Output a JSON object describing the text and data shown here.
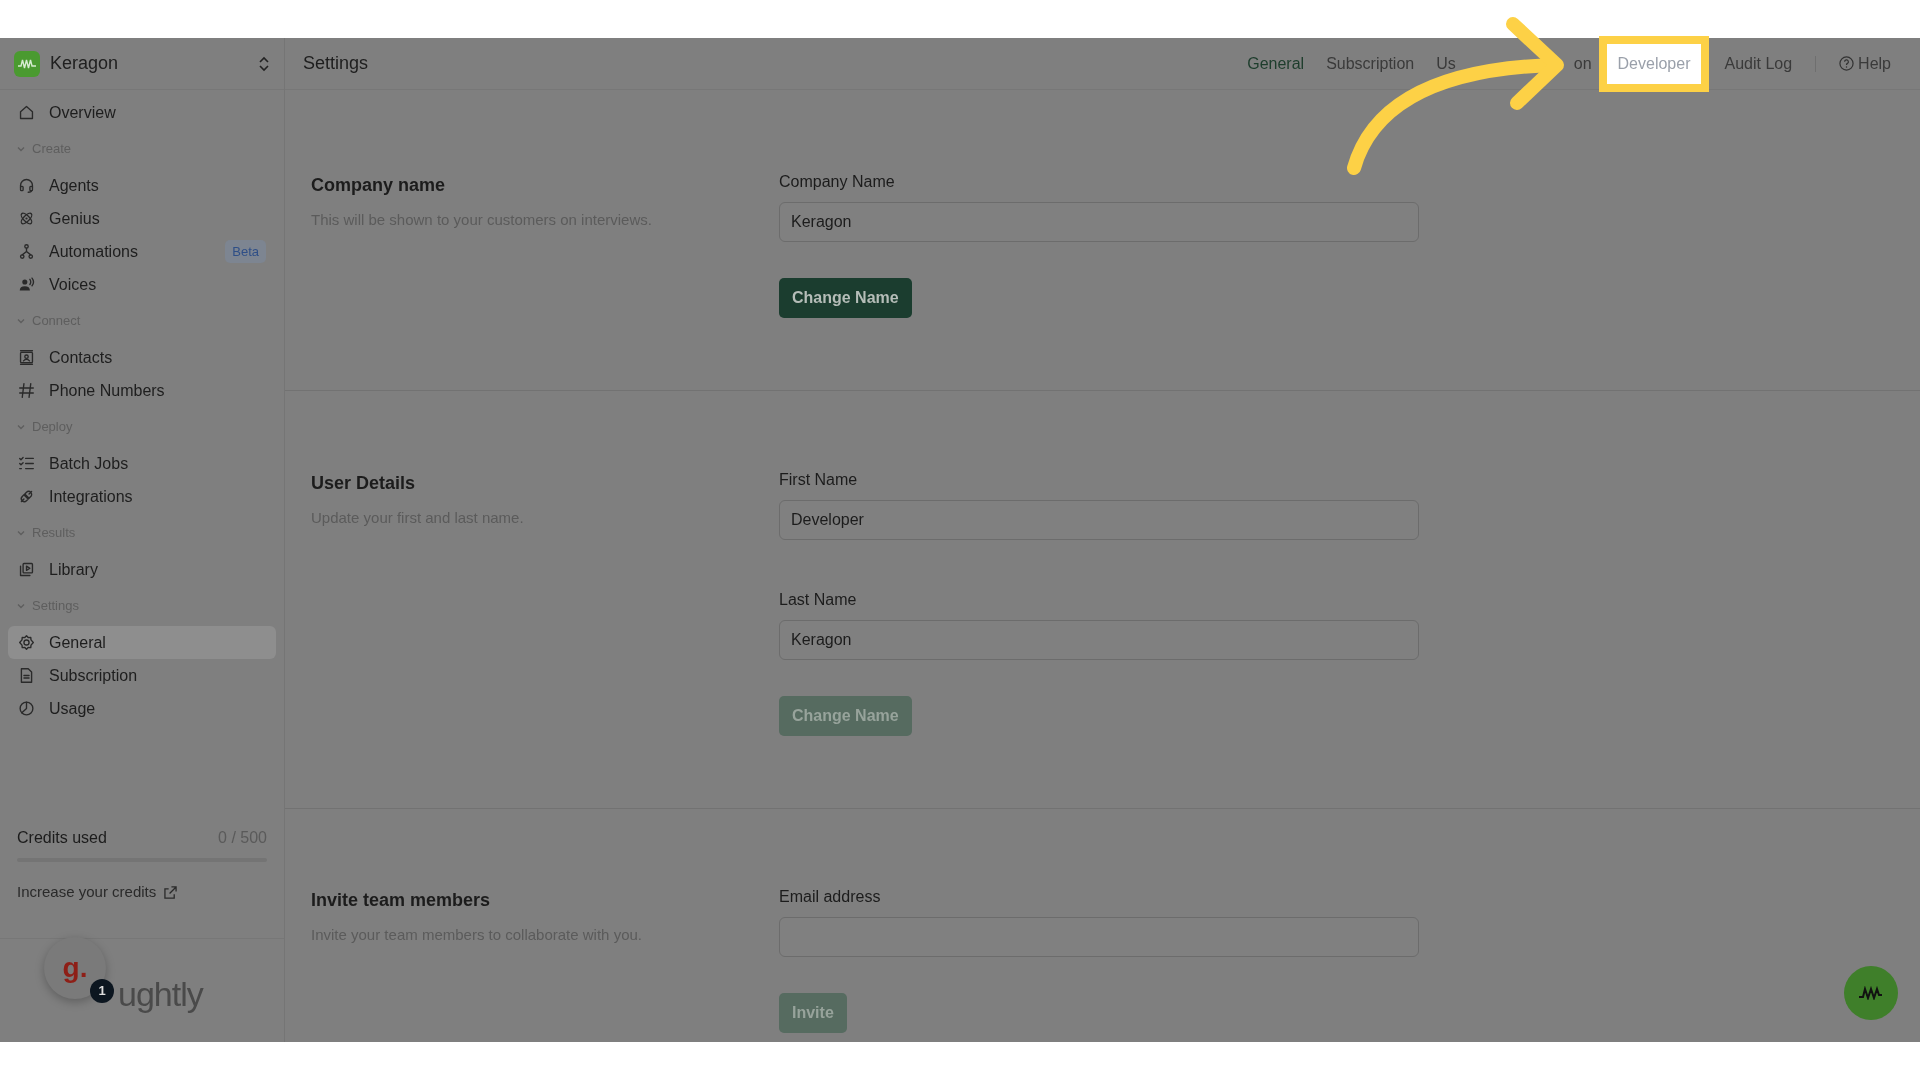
{
  "workspace": {
    "name": "Keragon"
  },
  "sidebar": {
    "items": [
      {
        "kind": "item",
        "label": "Overview",
        "selected": false
      },
      {
        "kind": "section",
        "label": "Create"
      },
      {
        "kind": "item",
        "label": "Agents",
        "selected": false
      },
      {
        "kind": "item",
        "label": "Genius",
        "selected": false
      },
      {
        "kind": "item",
        "label": "Automations",
        "selected": false,
        "badge": "Beta"
      },
      {
        "kind": "item",
        "label": "Voices",
        "selected": false
      },
      {
        "kind": "section",
        "label": "Connect"
      },
      {
        "kind": "item",
        "label": "Contacts",
        "selected": false
      },
      {
        "kind": "item",
        "label": "Phone Numbers",
        "selected": false
      },
      {
        "kind": "section",
        "label": "Deploy"
      },
      {
        "kind": "item",
        "label": "Batch Jobs",
        "selected": false
      },
      {
        "kind": "item",
        "label": "Integrations",
        "selected": false
      },
      {
        "kind": "section",
        "label": "Results"
      },
      {
        "kind": "item",
        "label": "Library",
        "selected": false
      },
      {
        "kind": "section",
        "label": "Settings"
      },
      {
        "kind": "item",
        "label": "General",
        "selected": true
      },
      {
        "kind": "item",
        "label": "Subscription",
        "selected": false
      },
      {
        "kind": "item",
        "label": "Usage",
        "selected": false
      }
    ],
    "credits": {
      "label": "Credits used",
      "value": "0 / 500",
      "level": 0
    },
    "credits_link": "Increase your credits",
    "widget": {
      "badge": "1",
      "logo_letter": "g.",
      "logo_text": "ughtly"
    }
  },
  "header": {
    "title": "Settings",
    "tabs": [
      {
        "label": "General",
        "selected": true,
        "highlighted": false
      },
      {
        "label": "Subscription",
        "selected": false,
        "highlighted": false
      },
      {
        "label": "Us",
        "selected": false,
        "highlighted": false
      },
      {
        "label": "on",
        "selected": false,
        "highlighted": false
      },
      {
        "label": "Developer",
        "selected": false,
        "highlighted": true
      },
      {
        "label": "Audit Log",
        "selected": false,
        "highlighted": false
      }
    ],
    "help": "Help"
  },
  "sections": [
    {
      "title": "Company name",
      "description": "This will be shown to your customers on interviews.",
      "fields": [
        {
          "label": "Company Name",
          "value": "Keragon"
        }
      ],
      "button": {
        "label": "Change Name",
        "disabled": false
      }
    },
    {
      "title": "User Details",
      "description": "Update your first and last name.",
      "fields": [
        {
          "label": "First Name",
          "value": "Developer"
        },
        {
          "label": "Last Name",
          "value": "Keragon"
        }
      ],
      "button": {
        "label": "Change Name",
        "disabled": true
      }
    },
    {
      "title": "Invite team members",
      "description": "Invite your team members to collaborate with you.",
      "fields": [
        {
          "label": "Email address"
        }
      ],
      "button": {
        "label": "Invite",
        "disabled": true
      }
    }
  ]
}
